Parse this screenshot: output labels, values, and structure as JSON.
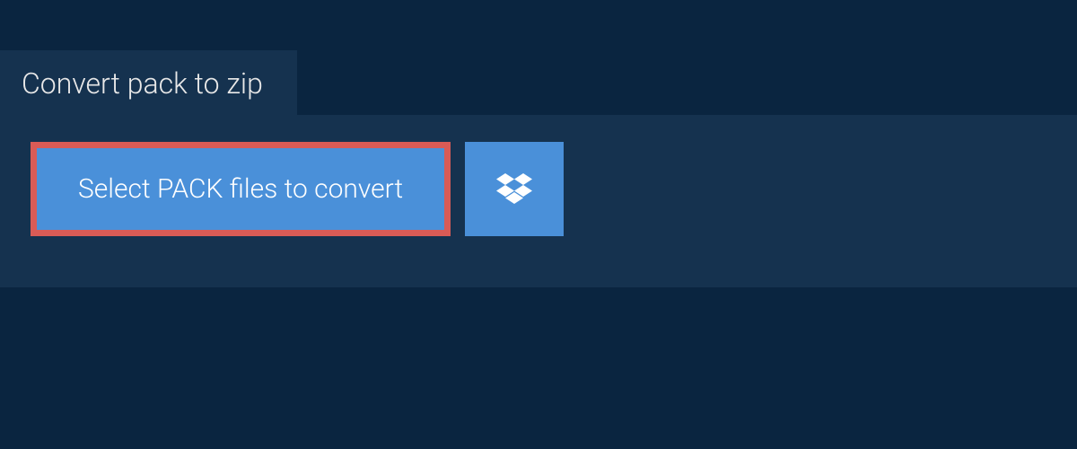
{
  "tab": {
    "label": "Convert pack to zip"
  },
  "buttons": {
    "select_label": "Select PACK files to convert"
  },
  "colors": {
    "background": "#0a2540",
    "panel": "#15324f",
    "button": "#4a90d9",
    "highlight_border": "#d95b56",
    "text_light": "#e8e8e8",
    "text_white": "#ffffff"
  }
}
